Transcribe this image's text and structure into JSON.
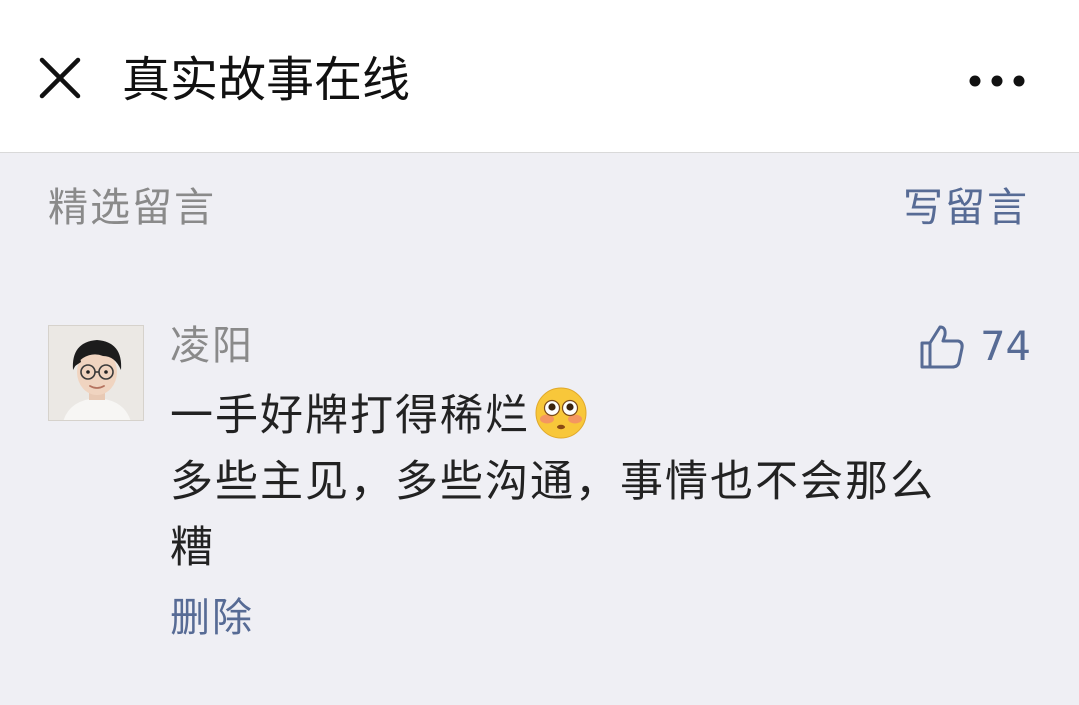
{
  "header": {
    "title": "真实故事在线",
    "close_icon": "close-icon",
    "more_icon": "more-icon"
  },
  "comments_section": {
    "title": "精选留言",
    "write_label": "写留言"
  },
  "comment": {
    "author": "凌阳",
    "likes": "74",
    "like_icon": "thumbs-up-icon",
    "line1": "一手好牌打得稀烂",
    "line1_emoji": "flushed-face-emoji",
    "line2": "多些主见，多些沟通，事情也不会那么",
    "line3": "糟",
    "delete_label": "删除"
  },
  "colors": {
    "link": "#576b95",
    "muted": "#8a8a8a",
    "background": "#efeff4"
  }
}
